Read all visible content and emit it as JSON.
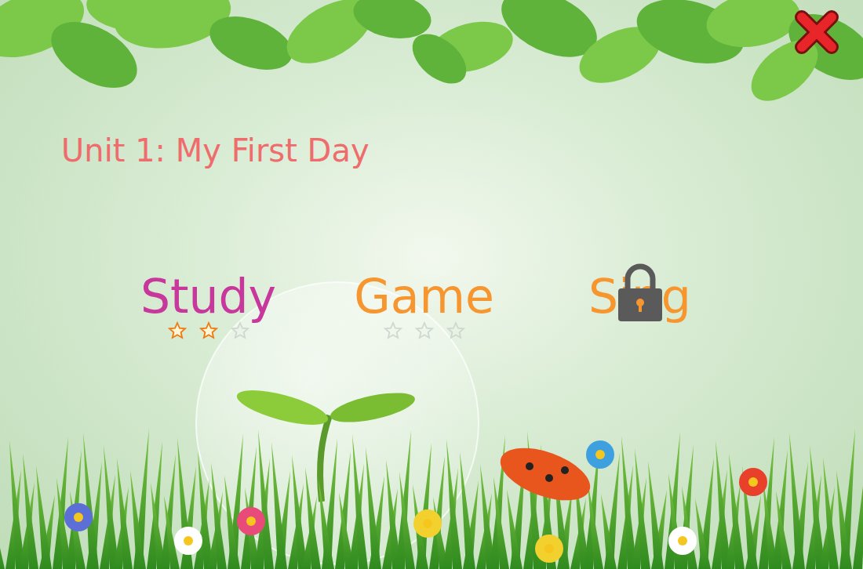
{
  "title": "Unit 1: My First Day",
  "menu": [
    {
      "label": "Study",
      "locked": false,
      "stars": 2,
      "color": "#c8389c"
    },
    {
      "label": "Game",
      "locked": false,
      "stars": 0,
      "color": "#f7952e"
    },
    {
      "label": "Sing",
      "locked": true,
      "color": "#f7952e"
    }
  ]
}
